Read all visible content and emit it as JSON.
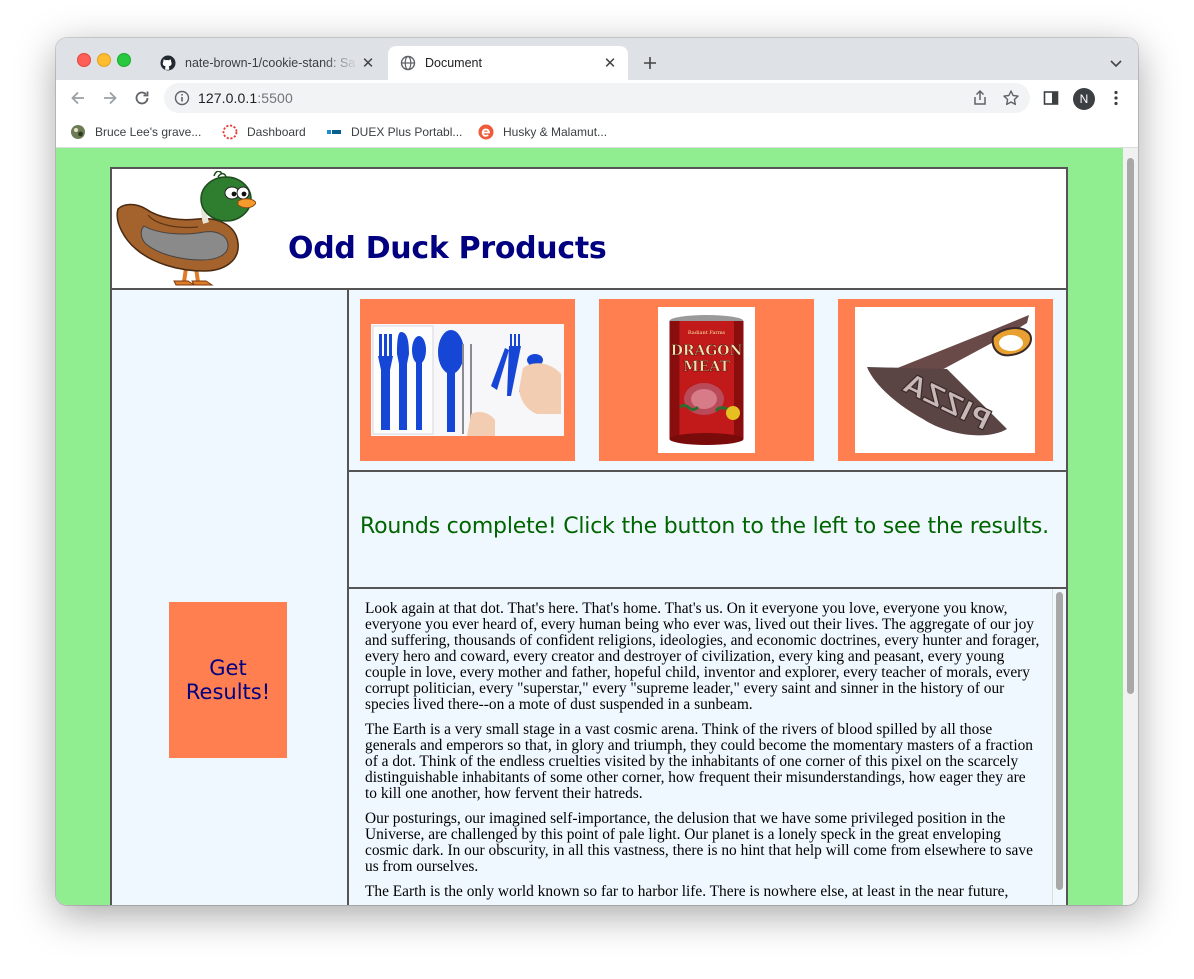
{
  "browser": {
    "tabs": [
      {
        "title": "nate-brown-1/cookie-stand: Sa",
        "favicon": "github-icon",
        "active": false
      },
      {
        "title": "Document",
        "favicon": "globe-icon",
        "active": true
      }
    ],
    "url_host": "127.0.0.1",
    "url_port": ":5500",
    "profile_initial": "N",
    "bookmarks": [
      {
        "label": "Bruce Lee's grave...",
        "icon": "bookmark-favicon-icon"
      },
      {
        "label": "Dashboard",
        "icon": "dashboard-favicon-icon"
      },
      {
        "label": "DUEX Plus Portabl...",
        "icon": "duex-favicon-icon"
      },
      {
        "label": "Husky & Malamut...",
        "icon": "husky-favicon-icon"
      }
    ]
  },
  "site": {
    "title": "Odd Duck Products",
    "results_button": "Get Results!",
    "message": "Rounds complete! Click the button to the left to see the results.",
    "products": [
      {
        "name": "utensils",
        "image": "blue-utensils-image"
      },
      {
        "name": "dragon-meat",
        "image": "dragon-meat-can-image",
        "can_label": "DRAGON MEAT"
      },
      {
        "name": "pizza-scissors",
        "image": "pizza-scissors-image",
        "label": "PIZZA"
      }
    ],
    "article": [
      "Look again at that dot. That's here. That's home. That's us. On it everyone you love, everyone you know, everyone you ever heard of, every human being who ever was, lived out their lives. The aggregate of our joy and suffering, thousands of confident religions, ideologies, and economic doctrines, every hunter and forager, every hero and coward, every creator and destroyer of civilization, every king and peasant, every young couple in love, every mother and father, hopeful child, inventor and explorer, every teacher of morals, every corrupt politician, every \"superstar,\" every \"supreme leader,\" every saint and sinner in the history of our species lived there--on a mote of dust suspended in a sunbeam.",
      "The Earth is a very small stage in a vast cosmic arena. Think of the rivers of blood spilled by all those generals and emperors so that, in glory and triumph, they could become the momentary masters of a fraction of a dot. Think of the endless cruelties visited by the inhabitants of one corner of this pixel on the scarcely distinguishable inhabitants of some other corner, how frequent their misunderstandings, how eager they are to kill one another, how fervent their hatreds.",
      "Our posturings, our imagined self-importance, the delusion that we have some privileged position in the Universe, are challenged by this point of pale light. Our planet is a lonely speck in the great enveloping cosmic dark. In our obscurity, in all this vastness, there is no hint that help will come from elsewhere to save us from ourselves.",
      "The Earth is the only world known so far to harbor life. There is nowhere else, at least in the near future,"
    ]
  },
  "colors": {
    "page_bg": "#90ee90",
    "panel_bg": "#f0f8ff",
    "accent": "#ff7f50",
    "title": "#000080",
    "message": "#006400"
  }
}
